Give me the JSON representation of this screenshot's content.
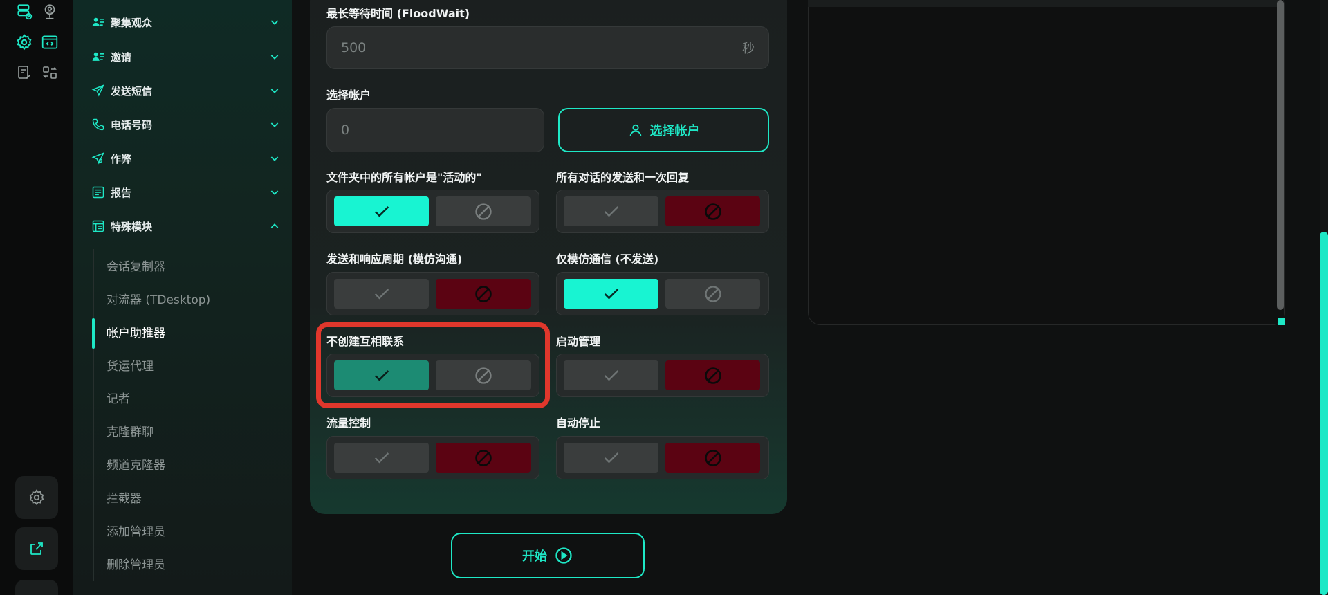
{
  "colors": {
    "accent": "#1ee8c6",
    "danger": "#5b0312",
    "highlight": "#e0372c"
  },
  "nav": {
    "items": [
      {
        "label": "聚集观众",
        "icon": "users-list-icon",
        "state": "collapsed"
      },
      {
        "label": "邀请",
        "icon": "users-list-icon",
        "state": "collapsed"
      },
      {
        "label": "发送短信",
        "icon": "paper-plane-icon",
        "state": "collapsed"
      },
      {
        "label": "电话号码",
        "icon": "phone-icon",
        "state": "collapsed"
      },
      {
        "label": "作弊",
        "icon": "plane-gear-icon",
        "state": "collapsed"
      },
      {
        "label": "报告",
        "icon": "report-icon",
        "state": "collapsed"
      },
      {
        "label": "特殊模块",
        "icon": "module-icon",
        "state": "expanded"
      }
    ],
    "sub_items": [
      "会话复制器",
      "对流器 (TDesktop)",
      "帐户助推器",
      "货运代理",
      "记者",
      "克隆群聊",
      "频道克隆器",
      "拦截器",
      "添加管理员",
      "删除管理员"
    ],
    "active_sub": "帐户助推器"
  },
  "form": {
    "flood_wait": {
      "label": "最长等待时间 (FloodWait)",
      "value": "500",
      "unit": "秒"
    },
    "select_account": {
      "label": "选择帐户",
      "value": "0",
      "button": "选择帐户"
    },
    "toggles": [
      {
        "label": "文件夹中的所有帐户是\"活动的\"",
        "state": "yes"
      },
      {
        "label": "所有对话的发送和一次回复",
        "state": "no"
      },
      {
        "label": "发送和响应周期 (模仿沟通)",
        "state": "no"
      },
      {
        "label": "仅模仿通信 (不发送)",
        "state": "yes"
      },
      {
        "label": "不创建互相联系",
        "state": "yes"
      },
      {
        "label": "启动管理",
        "state": "no"
      },
      {
        "label": "流量控制",
        "state": "no"
      },
      {
        "label": "自动停止",
        "state": "no"
      }
    ],
    "start_button": "开始"
  }
}
